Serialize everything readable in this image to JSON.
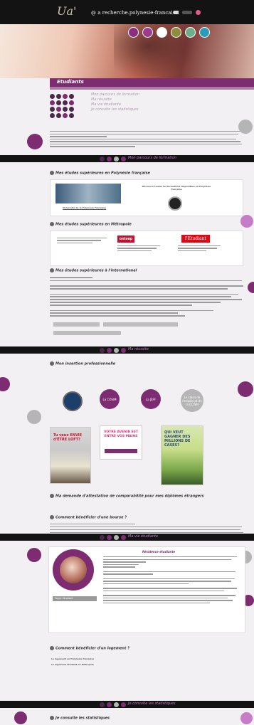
{
  "header": {
    "site_name": "@ a recherche.polynesie-francaise",
    "logo_script": "Ua'"
  },
  "page": {
    "title": "Etudiants",
    "menu": [
      "Mon parcours de formation",
      "Ma réussite",
      "Ma vie étudiante",
      "Je consulte les statistiques"
    ]
  },
  "sections": {
    "parcours": "Mon parcours de formation",
    "reussite": "Ma réussite",
    "vie": "Ma vie étudiante",
    "stats": "Je consulte les statistiques"
  },
  "blocks": {
    "etudes_pf": "Mes études supérieures en Polynésie française",
    "etudes_metro": "Mes études supérieures en Métropole",
    "etudes_etranger": "Mes études supérieures à l'international",
    "insertion": "Mon insertion professionnelle",
    "equivalence": "Ma demande d'attestation de comparabilité pour mes diplômes étrangers",
    "bourse": "Comment bénéficier d'une bourse ?",
    "logement": "Comment bénéficier d'un logement ?",
    "stats_sub": "Je consulte les statistiques"
  },
  "cards": {
    "upf_caption": "Université de la Polynésie Française",
    "decouvrir": "Découvrir toutes les formations disponibles en Polynésie française",
    "onisep": "onisep",
    "etudiant": "l'Etudiant"
  },
  "circles": {
    "cosim": "La COSIM",
    "jeff": "La JEFF",
    "salon": "Le salon de l'emploi et de la CCISM"
  },
  "posters": {
    "p1": "Tu veux ENVIE d'ÊTRE LOFT?",
    "p2": "VOTRE AVENIR EST ENTRE VOS MAINS",
    "p3": "QUI VEUT GAGNER DES MILLIONS DE CASES?"
  },
  "vie": {
    "photo_caption": "Foyer étudiant",
    "right_title": "Résidence étudiante"
  },
  "logement_links": [
    "Le logement en Polynésie française",
    "Le logement étudiant en Métropole"
  ],
  "colors": {
    "purple": "#7d2c72",
    "dark": "#141314",
    "pink": "#c77cc8",
    "grey": "#b5b5b5"
  }
}
